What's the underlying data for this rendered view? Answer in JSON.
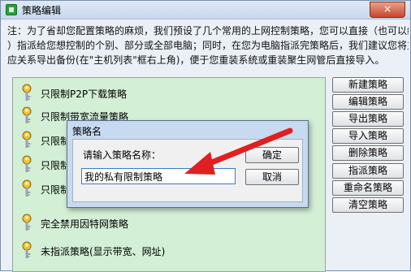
{
  "window": {
    "title": "策略编辑",
    "close_label": "×"
  },
  "notice": {
    "lines": [
      "注：为了省却您配置策略的麻烦，我们预设了几个常用的上网控制策略，您可以直接（也可以编辑、变更这些策略",
      "）指派给您想控制的个别、部分或全部电脑；同时，在您为电脑指派完策略后，我们建议您将主机和策略的对",
      "应关系导出备份(在\"主机列表\"框右上角)，便于您重装系统或重装聚生网管后直接导入。"
    ]
  },
  "policies": [
    {
      "label": "只限制P2P下载策略"
    },
    {
      "label": "只限制带宽流量策略"
    },
    {
      "label": "只限制"
    },
    {
      "label": "只限制"
    },
    {
      "label": "只限制"
    },
    {
      "label": "完全禁用因特网策略"
    },
    {
      "label": "未指派策略(显示带宽、网址)"
    }
  ],
  "buttons": {
    "new": "新建策略",
    "edit": "编辑策略",
    "export": "导出策略",
    "import": "导入策略",
    "delete": "删除策略",
    "assign": "指派策略",
    "rename": "重命名策略",
    "clear": "清空策略"
  },
  "dialog": {
    "title": "策略名",
    "prompt": "请输入策略名称：",
    "input_value": "我的私有限制策略",
    "ok": "确定",
    "cancel": "取消"
  },
  "colors": {
    "list_bg": "#d3efd6",
    "dialog_bg": "#c8daf0",
    "arrow": "#e02020"
  }
}
